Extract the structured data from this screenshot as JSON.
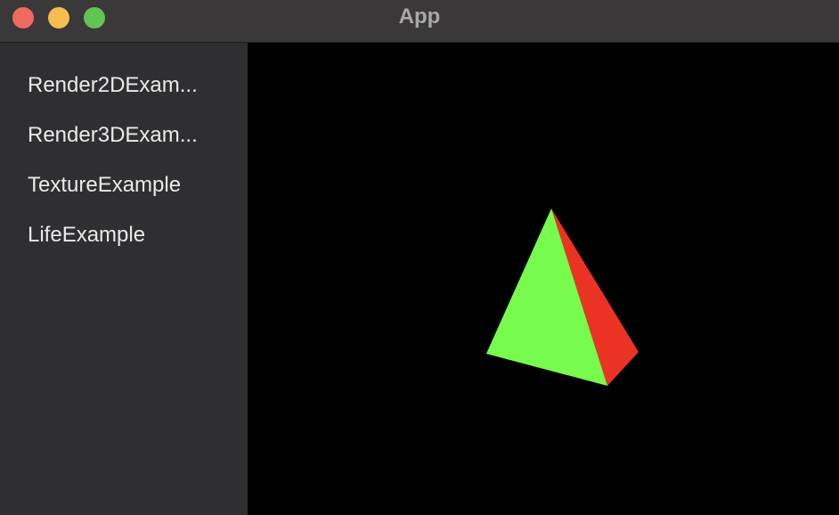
{
  "window": {
    "title": "App"
  },
  "sidebar": {
    "items": [
      {
        "label": "Render2DExam..."
      },
      {
        "label": "Render3DExam..."
      },
      {
        "label": "TextureExample"
      },
      {
        "label": "LifeExample"
      }
    ]
  },
  "canvas": {
    "object": "tetrahedron",
    "colors": {
      "front_face": "#77fb4c",
      "side_face": "#ea3323",
      "background": "#000000"
    }
  }
}
